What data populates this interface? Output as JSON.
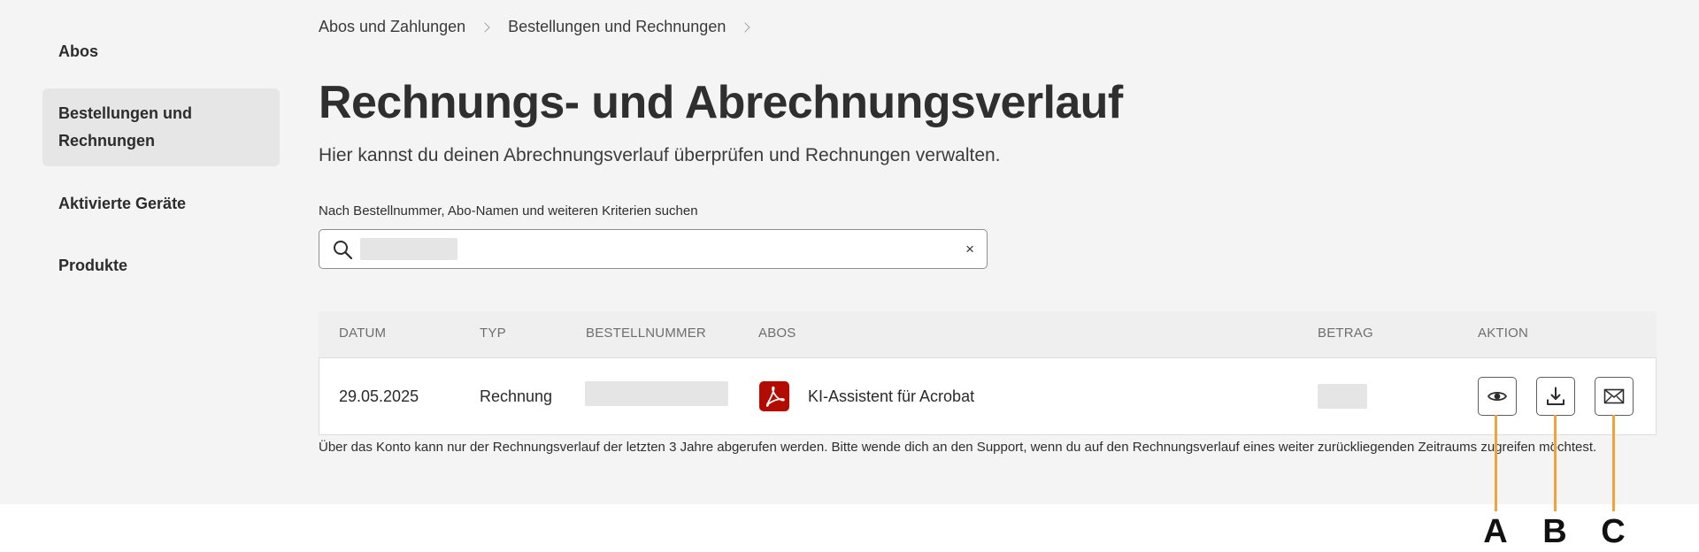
{
  "sidebar": {
    "items": [
      {
        "label": "Abos"
      },
      {
        "label": "Bestellungen und",
        "label2": "Rechnungen",
        "active": true
      },
      {
        "label": "Aktivierte Geräte"
      },
      {
        "label": "Produkte"
      }
    ]
  },
  "breadcrumb": [
    "Abos und Zahlungen",
    "Bestellungen und Rechnungen"
  ],
  "page": {
    "title": "Rechnungs- und Abrechnungsverlauf",
    "subtitle": "Hier kannst du deinen Abrechnungsverlauf überprüfen und Rechnungen verwalten."
  },
  "search": {
    "label": "Nach Bestellnummer, Abo-Namen und weiteren Kriterien suchen",
    "clear": "×"
  },
  "table": {
    "columns": [
      "DATUM",
      "TYP",
      "BESTELLNUMMER",
      "ABOS",
      "BETRAG",
      "AKTION"
    ],
    "rows": [
      {
        "date": "29.05.2025",
        "type": "Rechnung",
        "subscription": "KI-Assistent für Acrobat",
        "icon": "adobe-pdf-icon"
      }
    ],
    "actions": [
      "eye-icon",
      "download-icon",
      "mail-icon"
    ]
  },
  "footnote": "Über das Konto kann nur der Rechnungsverlauf der letzten 3 Jahre abgerufen werden. Bitte wende dich an den Support, wenn du auf den Rechnungsverlauf eines weiter zurückliegenden Zeitraums zugreifen möchtest.",
  "annotations": [
    "A",
    "B",
    "C"
  ],
  "colors": {
    "accent_callout": "#f2a23a",
    "pdf_red": "#b30b00"
  }
}
